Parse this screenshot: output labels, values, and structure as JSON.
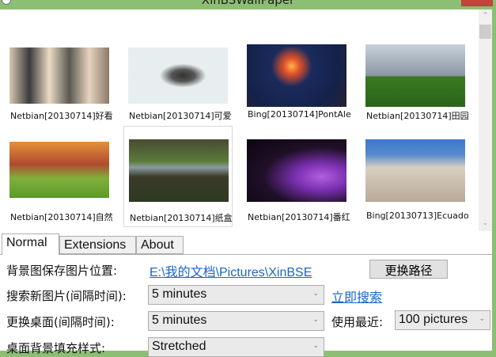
{
  "window": {
    "title": "XinBSWallPaper"
  },
  "gallery": [
    {
      "label": "Netbian[20130714]好看"
    },
    {
      "label": "Netbian[20130714]可爱"
    },
    {
      "label": "Bing[20130714]PontAle"
    },
    {
      "label": "Netbian[20130714]田园"
    },
    {
      "label": "Netbian[20130714]自然"
    },
    {
      "label": "Netbian[20130714]纸盒"
    },
    {
      "label": "Netbian[20130714]番红"
    },
    {
      "label": "Bing[20130713]Ecuado"
    }
  ],
  "tabs": [
    "Normal",
    "Extensions",
    "About"
  ],
  "settings": {
    "save_path_label": "背景图保存图片位置:",
    "save_path_value": "E:\\我的文档\\Pictures\\XinBSE",
    "change_path_button": "更换路径",
    "search_interval_label": "搜索新图片(间隔时间):",
    "search_interval_value": "5 minutes",
    "search_now_link": "立即搜索",
    "change_interval_label": "更换桌面(间隔时间):",
    "change_interval_value": "5 minutes",
    "use_recent_label": "使用最近:",
    "use_recent_value": "100 pictures",
    "fill_style_label": "桌面背景填充样式:",
    "fill_style_value": "Stretched"
  }
}
